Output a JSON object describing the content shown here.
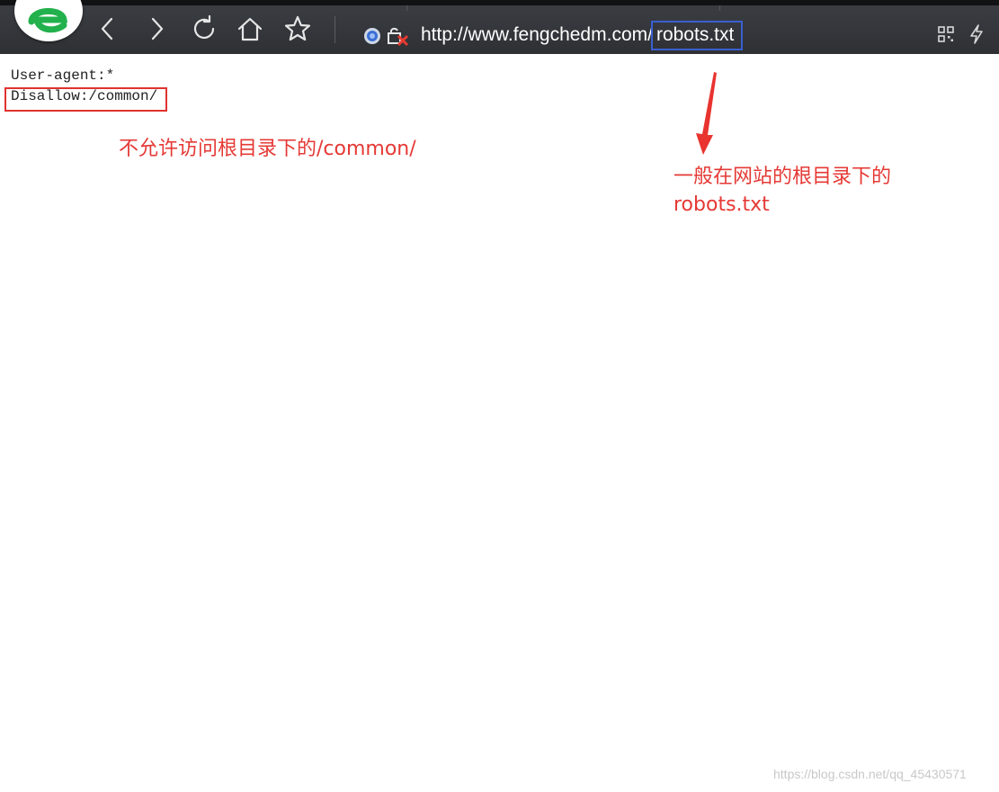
{
  "toolbar": {
    "url_prefix": "http://www.fengchedm.com/",
    "url_highlight": "robots.txt"
  },
  "icons": {
    "logo": "browser-logo-e-icon",
    "back": "chevron-left-icon",
    "forward": "chevron-right-icon",
    "reload": "reload-icon",
    "home": "home-icon",
    "favorite": "star-icon",
    "site": "site-globe-icon",
    "insecure": "not-secure-lock-icon",
    "qr": "qr-code-icon",
    "bolt": "lightning-icon"
  },
  "content": {
    "lines": [
      "User-agent:*",
      "Disallow:/common/"
    ]
  },
  "annotations": {
    "note1": "不允许访问根目录下的/common/",
    "note2_line1": "一般在网站的根目录下的",
    "note2_line2": "robots.txt"
  },
  "watermark": "https://blog.csdn.net/qq_45430571",
  "colors": {
    "annotation": "#e53935",
    "url_highlight_box": "#3a5fd0",
    "toolbar": "#2e3034"
  }
}
